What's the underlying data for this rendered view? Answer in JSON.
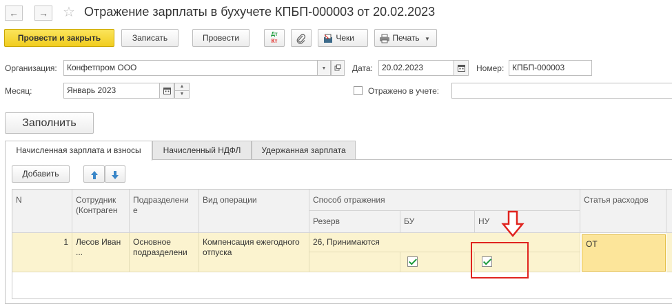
{
  "titlebar": {
    "back_glyph": "←",
    "forward_glyph": "→",
    "title": "Отражение зарплаты в бухучете КПБП-000003 от 20.02.2023"
  },
  "toolbar": {
    "post_close_label": "Провести и закрыть",
    "save_label": "Записать",
    "post_label": "Провести",
    "dtkt_icon_top": "Дт",
    "dtkt_icon_bottom": "Кт",
    "receipts_label": "Чеки",
    "print_label": "Печать"
  },
  "form": {
    "org_label": "Организация:",
    "org_value": "Конфетпром ООО",
    "date_label": "Дата:",
    "date_value": "20.02.2023",
    "number_label": "Номер:",
    "number_value": "КПБП-000003",
    "month_label": "Месяц:",
    "month_value": "Январь 2023",
    "reflected_label": "Отражено в учете:",
    "reflected_value": "",
    "fill_button": "Заполнить"
  },
  "tabs": [
    {
      "label": "Начисленная зарплата и взносы",
      "active": true
    },
    {
      "label": "Начисленный НДФЛ",
      "active": false
    },
    {
      "label": "Удержанная зарплата",
      "active": false
    }
  ],
  "table_toolbar": {
    "add_label": "Добавить"
  },
  "grid": {
    "headers": {
      "n": "N",
      "employee": "Сотрудник (Контраген",
      "department": "Подразделени е",
      "operation": "Вид операции",
      "method": "Способ отражения",
      "reserve": "Резерв",
      "bu": "БУ",
      "nu": "НУ",
      "expense": "Статья расходов"
    },
    "rows": [
      {
        "n": "1",
        "employee": "Лесов Иван ...",
        "department": "Основное подразделени",
        "operation": "Компенсация ежегодного отпуска",
        "method": "26, Принимаются",
        "bu_checked": true,
        "nu_checked": true,
        "expense": "ОТ"
      }
    ]
  },
  "colors": {
    "primary_button": "#f5d42a",
    "row_highlight": "#fbf3cf",
    "annotation": "#e0231e",
    "check": "#1a9a3a"
  }
}
